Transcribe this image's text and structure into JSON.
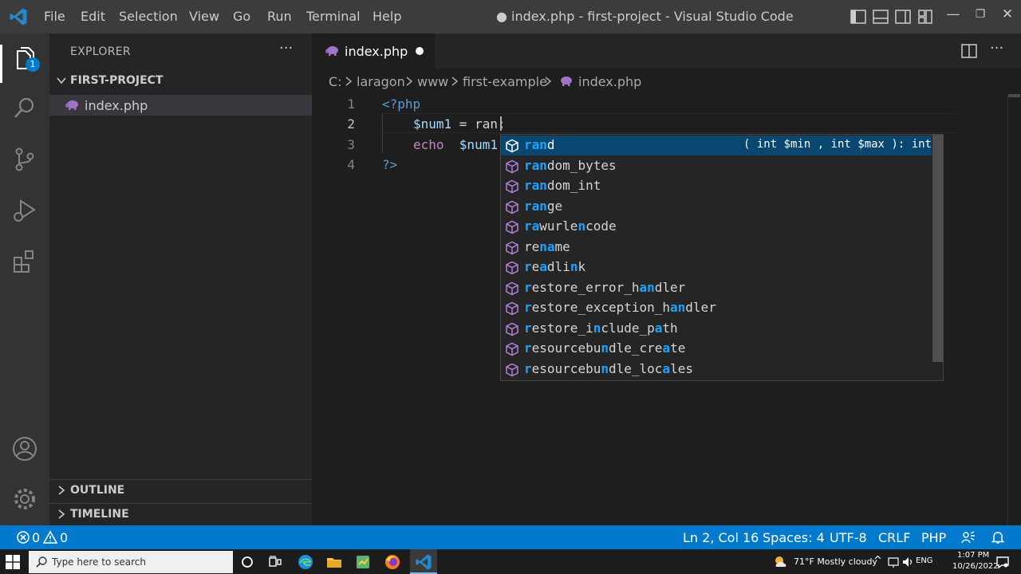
{
  "window": {
    "title": "● index.php - first-project - Visual Studio Code",
    "menu": [
      "File",
      "Edit",
      "Selection",
      "View",
      "Go",
      "Run",
      "Terminal",
      "Help"
    ]
  },
  "activity_bar": {
    "icons": [
      "files-icon",
      "search-icon",
      "source-control-icon",
      "run-debug-icon",
      "extensions-icon",
      "account-icon",
      "settings-gear-icon"
    ],
    "explorer_badge": "1"
  },
  "sidebar": {
    "title": "EXPLORER",
    "more": "···",
    "project": "FIRST-PROJECT",
    "files": [
      "index.php"
    ],
    "outline": "OUTLINE",
    "timeline": "TIMELINE"
  },
  "editor": {
    "tab_label": "index.php",
    "more": "···",
    "breadcrumbs": [
      "C:",
      "laragon",
      "www",
      "first-example",
      "index.php"
    ],
    "line_numbers": [
      "1",
      "2",
      "3",
      "4"
    ],
    "lines": {
      "l1": "<?php",
      "l2_var": "$num1",
      "l2_rest": " = ran;",
      "l3_kw": "echo",
      "l3_var": "  $num1",
      "l4": "?>"
    }
  },
  "suggestions": {
    "items": [
      {
        "parts": [
          [
            "ran",
            true
          ],
          [
            "d",
            false
          ]
        ],
        "detail": "( int $min , int $max ): int",
        "selected": true
      },
      {
        "parts": [
          [
            "ran",
            true
          ],
          [
            "dom_bytes",
            false
          ]
        ]
      },
      {
        "parts": [
          [
            "ran",
            true
          ],
          [
            "dom_int",
            false
          ]
        ]
      },
      {
        "parts": [
          [
            "ra",
            true
          ],
          [
            "n",
            true
          ],
          [
            "ge",
            false
          ]
        ]
      },
      {
        "parts": [
          [
            "ra",
            true
          ],
          [
            "wurle",
            false
          ],
          [
            "n",
            true
          ],
          [
            "code",
            false
          ]
        ]
      },
      {
        "parts": [
          [
            "re",
            false
          ],
          [
            "na",
            true
          ],
          [
            "me",
            false
          ]
        ]
      },
      {
        "parts": [
          [
            "r",
            true
          ],
          [
            "e",
            false
          ],
          [
            "a",
            true
          ],
          [
            "dli",
            false
          ],
          [
            "n",
            true
          ],
          [
            "k",
            false
          ]
        ]
      },
      {
        "parts": [
          [
            "r",
            true
          ],
          [
            "estore_error_h",
            false
          ],
          [
            "an",
            true
          ],
          [
            "dler",
            false
          ]
        ]
      },
      {
        "parts": [
          [
            "r",
            true
          ],
          [
            "estore_exception_h",
            false
          ],
          [
            "an",
            true
          ],
          [
            "dler",
            false
          ]
        ]
      },
      {
        "parts": [
          [
            "r",
            true
          ],
          [
            "estore_i",
            false
          ],
          [
            "n",
            true
          ],
          [
            "clude_p",
            false
          ],
          [
            "a",
            true
          ],
          [
            "th",
            false
          ]
        ]
      },
      {
        "parts": [
          [
            "r",
            true
          ],
          [
            "esourcebu",
            false
          ],
          [
            "n",
            true
          ],
          [
            "dle_cre",
            false
          ],
          [
            "a",
            true
          ],
          [
            "te",
            false
          ]
        ]
      },
      {
        "parts": [
          [
            "r",
            true
          ],
          [
            "esourcebu",
            false
          ],
          [
            "n",
            true
          ],
          [
            "dle_loc",
            false
          ],
          [
            "a",
            true
          ],
          [
            "les",
            false
          ]
        ]
      }
    ]
  },
  "status_bar": {
    "errors": "0",
    "warnings": "0",
    "position": "Ln 2, Col 16",
    "spaces": "Spaces: 4",
    "encoding": "UTF-8",
    "eol": "CRLF",
    "language": "PHP"
  },
  "taskbar": {
    "search_placeholder": "Type here to search",
    "weather": "71°F  Mostly cloudy",
    "lang": "ENG",
    "time": "1:07 PM",
    "date": "10/26/2022"
  },
  "colors": {
    "accent": "#007acc",
    "selection": "#094771",
    "match_highlight": "#18a3ff",
    "php_icon": "#a074c4"
  }
}
